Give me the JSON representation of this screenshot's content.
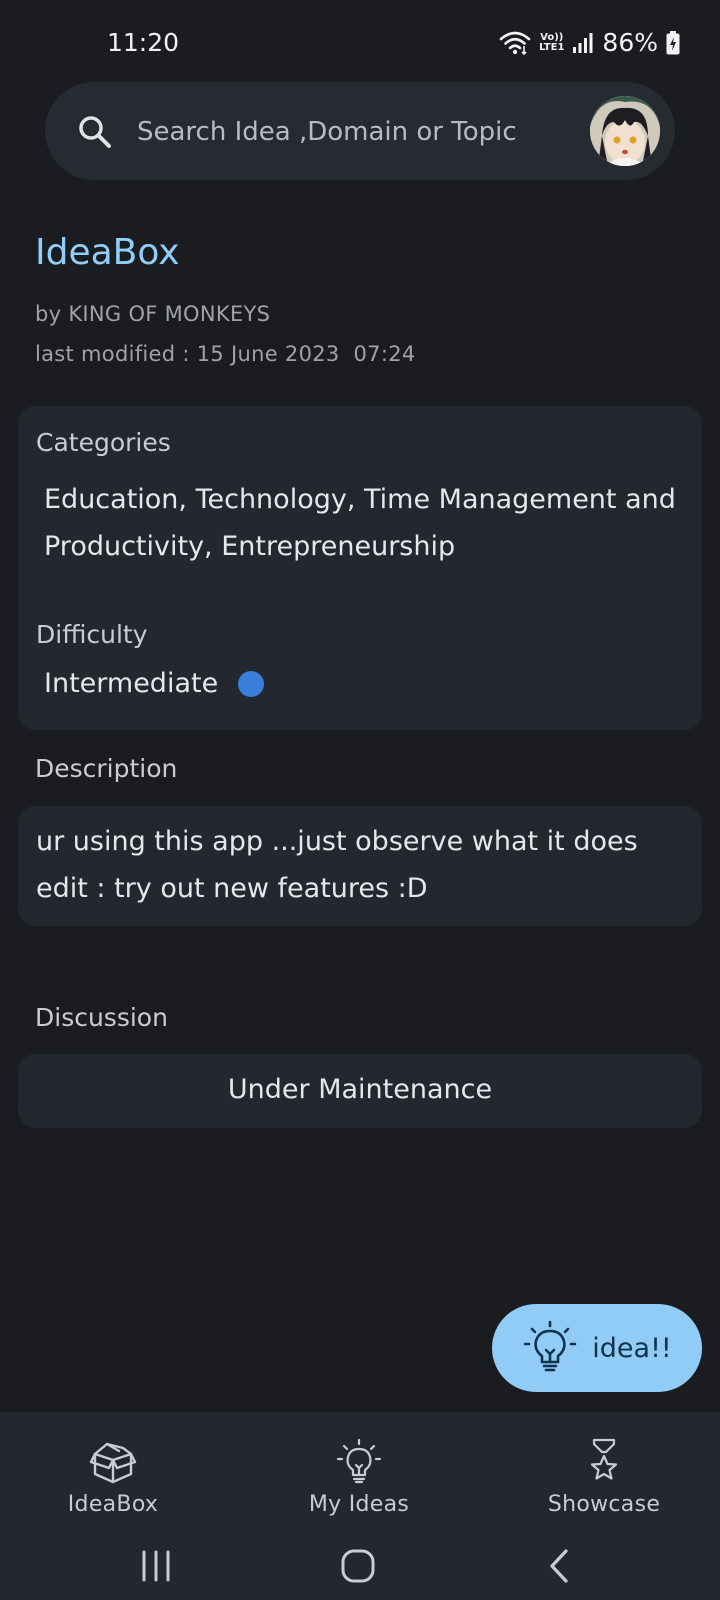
{
  "status_bar": {
    "time": "11:20",
    "lte_top": "Vo))",
    "lte_bottom": "LTE1",
    "battery": "86%"
  },
  "search": {
    "placeholder": "Search Idea ,Domain or Topic"
  },
  "idea": {
    "title": "IdeaBox",
    "author": "by KING OF MONKEYS",
    "last_modified": "last modified : 15 June 2023  07:24"
  },
  "info_card": {
    "categories_label": "Categories",
    "categories_value": "Education, Technology, Time Management and Productivity, Entrepreneurship",
    "difficulty_label": "Difficulty",
    "difficulty_value": "Intermediate",
    "difficulty_color": "#3a7ed9"
  },
  "description": {
    "label": "Description",
    "line1": "ur using this app ...just observe what it does",
    "line2": "edit : try out new features :D"
  },
  "discussion": {
    "label": "Discussion",
    "status": "Under Maintenance"
  },
  "fab": {
    "label": "idea!!",
    "icon": "lightbulb-icon"
  },
  "bottom_nav": {
    "items": [
      {
        "label": "IdeaBox",
        "icon": "box-icon"
      },
      {
        "label": "My Ideas",
        "icon": "lightbulb-icon"
      },
      {
        "label": "Showcase",
        "icon": "trophy-icon"
      }
    ]
  },
  "colors": {
    "background": "#1b1c1f",
    "card": "#23272e",
    "accent": "#90cdf8",
    "fab": "#91ccf6"
  }
}
